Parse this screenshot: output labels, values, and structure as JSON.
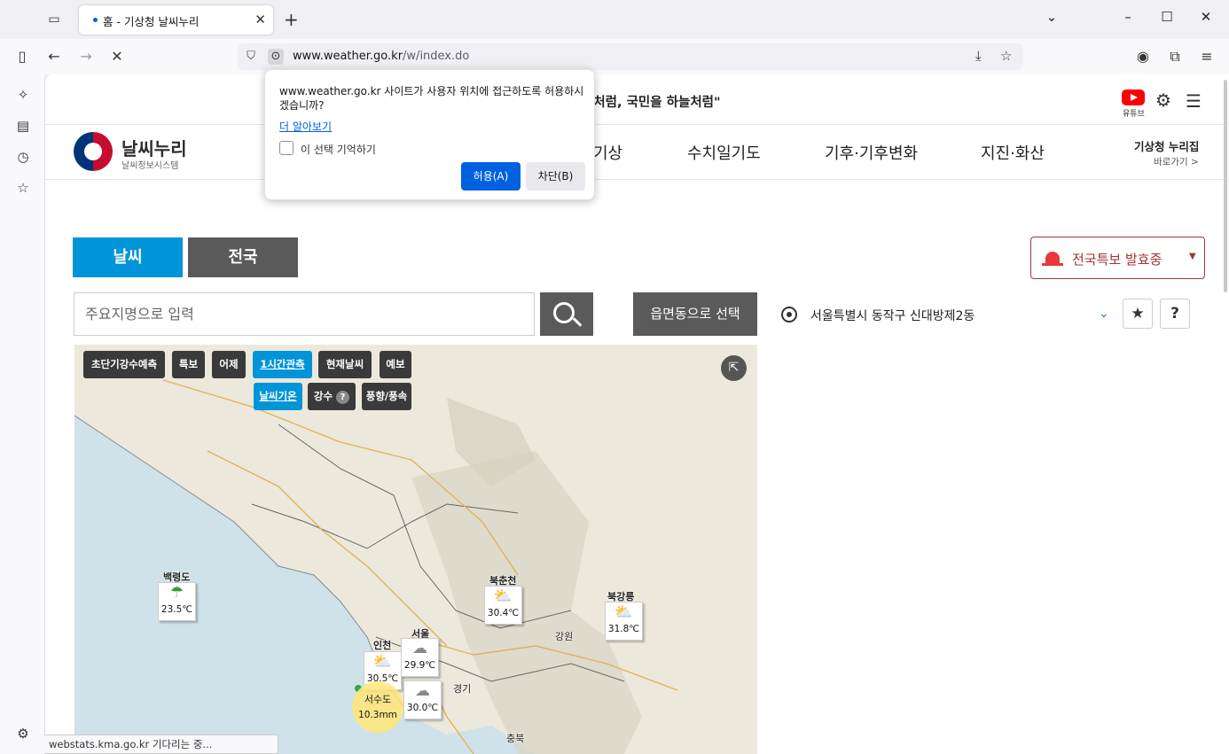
{
  "browser": {
    "tab_title": "홈 - 기상청 날씨누리",
    "url_domain": "www.weather.go.kr",
    "url_path": "/w/index.do",
    "status_text": "webstats.kma.go.kr 기다리는 중..."
  },
  "permission_popup": {
    "message": "www.weather.go.kr 사이트가 사용자 위치에 접근하도록 허용하시겠습니까?",
    "learn_more": "더 알아보기",
    "remember_label": "이 선택 기억하기",
    "allow_label": "허용(A)",
    "block_label": "차단(B)"
  },
  "site": {
    "slogan": "구처럼, 국민을 하늘처럼\"",
    "youtube_label": "유튜브",
    "logo_title": "날씨누리",
    "logo_sub": "날씨정보시스템",
    "nav": [
      "기상",
      "수치일기도",
      "기후·기후변화",
      "지진·화산"
    ],
    "nuri_title": "기상청 누리집",
    "nuri_sub": "바로가기 >",
    "tab_weather": "날씨",
    "tab_national": "전국",
    "warning_label": "전국특보 발효중",
    "search_placeholder": "주요지명으로 입력",
    "dong_button": "읍면동으로 선택",
    "location_text": "서울특별시 동작구 신대방제2동",
    "help_label": "?"
  },
  "map": {
    "chips_row1": [
      "초단기강수예측",
      "특보",
      "어제",
      "1시간관측",
      "현재날씨",
      "예보"
    ],
    "chips_row2": [
      "날씨기온",
      "강수",
      "풍향/풍속"
    ],
    "places": [
      "백령도",
      "북춘천",
      "북강릉",
      "인천",
      "서울",
      "강원",
      "경기",
      "충북"
    ],
    "cards": [
      {
        "place": "백령도",
        "icon": "umbrella-icon",
        "temp": "23.5℃"
      },
      {
        "place": "북춘천",
        "icon": "sun-cloud-icon",
        "temp": "30.4℃"
      },
      {
        "place": "북강릉",
        "icon": "sun-cloud-icon",
        "temp": "31.8℃"
      },
      {
        "place": "인천",
        "icon": "sun-cloud-icon",
        "temp": "30.5℃"
      },
      {
        "place": "서울",
        "icon": "cloud-icon",
        "temp": "29.9℃"
      },
      {
        "place": "경기",
        "icon": "cloud-icon",
        "temp": "30.0℃"
      }
    ],
    "wave": {
      "name": "서수도",
      "value": "10.3mm"
    }
  },
  "colors": {
    "accent": "#0094d9",
    "dark_tab": "#5a5a5a",
    "warning": "#a4343a"
  }
}
